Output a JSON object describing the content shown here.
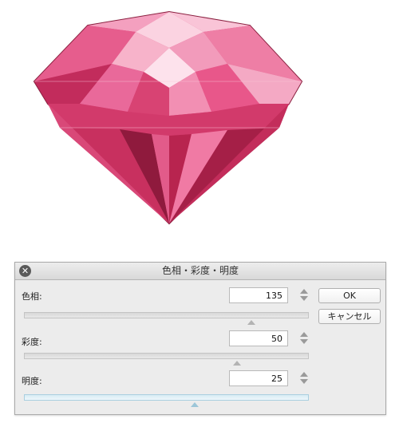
{
  "dialog": {
    "title": "色相・彩度・明度",
    "close_icon": "close-icon"
  },
  "rows": [
    {
      "label": "色相:",
      "value": "135",
      "slider_fraction": 0.8
    },
    {
      "label": "彩度:",
      "value": "50",
      "slider_fraction": 0.75
    },
    {
      "label": "明度:",
      "value": "25",
      "slider_fraction": 0.6
    }
  ],
  "buttons": {
    "ok": "OK",
    "cancel": "キャンセル"
  },
  "icons": {
    "stepper": "stepper-arrows-icon",
    "gem": "gem-illustration"
  },
  "colors": {
    "gem_main": "#e0457a",
    "gem_light": "#f6a8c4",
    "gem_dark": "#9e1d45",
    "gem_outline": "#8a1f3f",
    "active_slider": "#a9cfe0"
  }
}
